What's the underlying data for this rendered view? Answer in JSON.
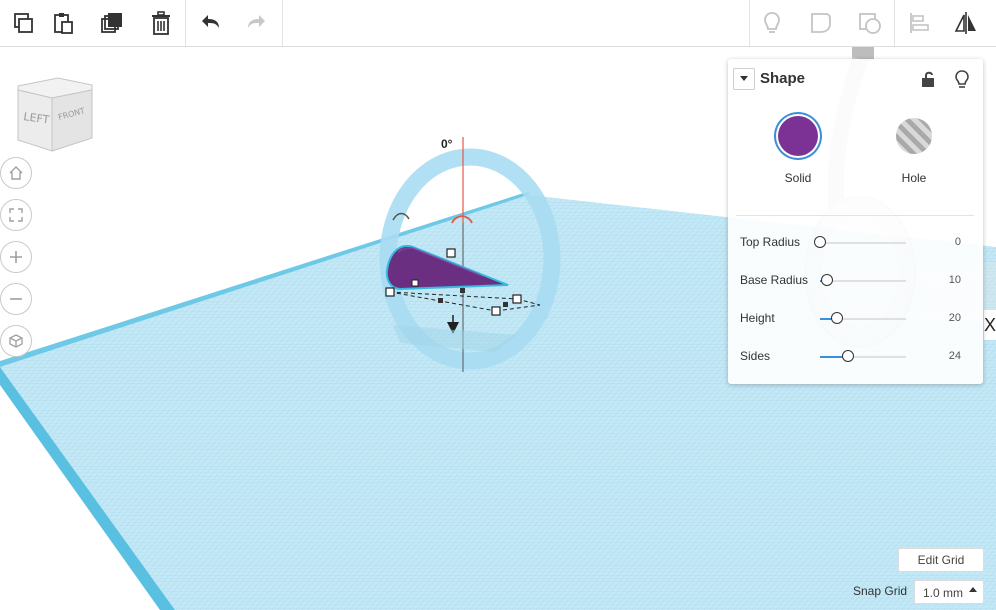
{
  "toolbar": {
    "left_tools": [
      {
        "name": "copy",
        "icon": "copy-icon"
      },
      {
        "name": "paste",
        "icon": "paste-icon"
      },
      {
        "name": "duplicate",
        "icon": "duplicate-icon"
      },
      {
        "name": "delete",
        "icon": "trash-icon"
      },
      {
        "name": "undo",
        "icon": "undo-icon"
      },
      {
        "name": "redo",
        "icon": "redo-icon"
      }
    ],
    "right_tools": [
      {
        "name": "show-all",
        "icon": "lightbulb-icon"
      },
      {
        "name": "group",
        "icon": "group-icon"
      },
      {
        "name": "ungroup",
        "icon": "ungroup-icon"
      },
      {
        "name": "align",
        "icon": "align-icon"
      },
      {
        "name": "mirror",
        "icon": "mirror-icon"
      }
    ]
  },
  "viewcube": {
    "left_face": "LEFT",
    "front_face": "FRONT"
  },
  "nav_buttons": [
    {
      "name": "home-view",
      "icon": "home-icon"
    },
    {
      "name": "fit-view",
      "icon": "fit-icon"
    },
    {
      "name": "zoom-in",
      "icon": "plus-icon"
    },
    {
      "name": "zoom-out",
      "icon": "minus-icon"
    },
    {
      "name": "perspective",
      "icon": "cube-icon"
    }
  ],
  "rotation": {
    "angle_label": "0°"
  },
  "inspector": {
    "title": "Shape",
    "solid_label": "Solid",
    "hole_label": "Hole",
    "solid_color": "#7b3294",
    "props": [
      {
        "label": "Top Radius",
        "value": "0",
        "fraction": 0.0
      },
      {
        "label": "Base Radius",
        "value": "10",
        "fraction": 0.08
      },
      {
        "label": "Height",
        "value": "20",
        "fraction": 0.2
      },
      {
        "label": "Sides",
        "value": "24",
        "fraction": 0.33
      }
    ]
  },
  "grid": {
    "edit_label": "Edit Grid",
    "snap_label": "Snap Grid",
    "snap_value": "1.0 mm"
  },
  "colors": {
    "workplane": "#b8e2f2",
    "grid_line": "#7fc7e3",
    "accent": "#3b8fd9",
    "shape": "#6a2f80"
  }
}
